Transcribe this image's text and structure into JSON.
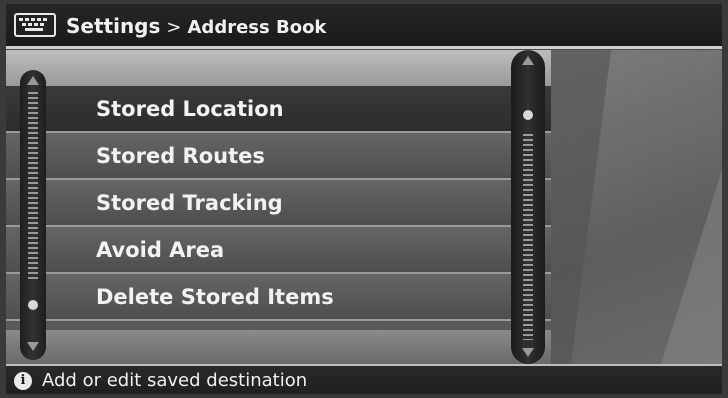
{
  "header": {
    "icon": "keyboard-icon",
    "breadcrumb_main": "Settings",
    "breadcrumb_separator": ">",
    "breadcrumb_sub": "Address Book"
  },
  "menu": {
    "items": [
      {
        "label": "Stored Location",
        "selected": true
      },
      {
        "label": "Stored Routes",
        "selected": false
      },
      {
        "label": "Stored Tracking",
        "selected": false
      },
      {
        "label": "Avoid Area",
        "selected": false
      },
      {
        "label": "Delete Stored Items",
        "selected": false
      }
    ]
  },
  "footer": {
    "icon": "info-icon",
    "info_glyph": "i",
    "message": "Add or edit saved destination"
  }
}
